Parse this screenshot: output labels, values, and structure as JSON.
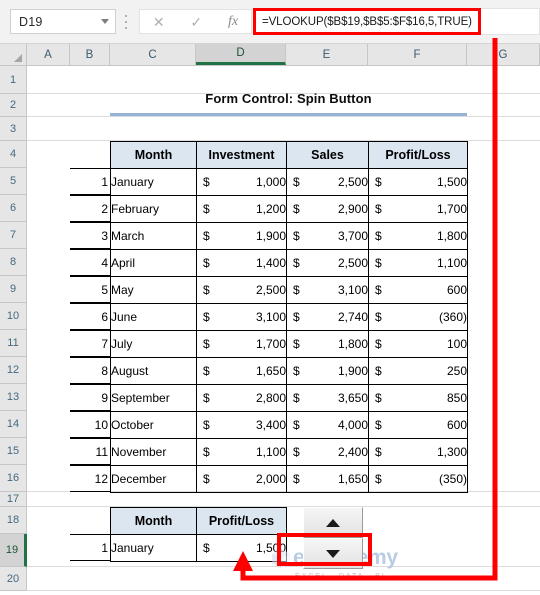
{
  "formula_bar": {
    "name_box_value": "D19",
    "formula": "=VLOOKUP($B$19,$B$5:$F$16,5,TRUE)",
    "cancel_icon": "cancel-x-icon",
    "enter_icon": "checkmark-icon",
    "fx_icon": "fx",
    "cancel_glyph": "✕",
    "enter_glyph": "✓"
  },
  "columns": [
    "A",
    "B",
    "C",
    "D",
    "E",
    "F",
    "G"
  ],
  "selected_column": "D",
  "rows": [
    "1",
    "2",
    "3",
    "4",
    "5",
    "6",
    "7",
    "8",
    "9",
    "10",
    "11",
    "12",
    "13",
    "14",
    "15",
    "16",
    "17",
    "18",
    "19",
    "20"
  ],
  "selected_row": "19",
  "sheet": {
    "title": "Form Control: Spin Button"
  },
  "main_table": {
    "headers": [
      "Month",
      "Investment",
      "Sales",
      "Profit/Loss"
    ],
    "rows": [
      {
        "index": "1",
        "month": "January",
        "investment": "1,000",
        "sales": "2,500",
        "profit_loss": "1,500"
      },
      {
        "index": "2",
        "month": "February",
        "investment": "1,200",
        "sales": "2,900",
        "profit_loss": "1,700"
      },
      {
        "index": "3",
        "month": "March",
        "investment": "1,900",
        "sales": "3,700",
        "profit_loss": "1,800"
      },
      {
        "index": "4",
        "month": "April",
        "investment": "1,400",
        "sales": "2,500",
        "profit_loss": "1,100"
      },
      {
        "index": "5",
        "month": "May",
        "investment": "2,500",
        "sales": "3,100",
        "profit_loss": "600"
      },
      {
        "index": "6",
        "month": "June",
        "investment": "3,100",
        "sales": "2,740",
        "profit_loss": "(360)"
      },
      {
        "index": "7",
        "month": "July",
        "investment": "1,700",
        "sales": "1,800",
        "profit_loss": "100"
      },
      {
        "index": "8",
        "month": "August",
        "investment": "1,650",
        "sales": "1,900",
        "profit_loss": "250"
      },
      {
        "index": "9",
        "month": "September",
        "investment": "2,800",
        "sales": "3,650",
        "profit_loss": "850"
      },
      {
        "index": "10",
        "month": "October",
        "investment": "3,400",
        "sales": "4,000",
        "profit_loss": "600"
      },
      {
        "index": "11",
        "month": "November",
        "investment": "1,100",
        "sales": "2,400",
        "profit_loss": "1,300"
      },
      {
        "index": "12",
        "month": "December",
        "investment": "2,000",
        "sales": "1,650",
        "profit_loss": "(350)"
      }
    ],
    "currency_symbol": "$"
  },
  "lookup_table": {
    "headers": [
      "Month",
      "Profit/Loss"
    ],
    "row": {
      "index": "1",
      "month": "January",
      "profit_loss": "1,500"
    },
    "currency_symbol": "$"
  },
  "spin_button": {
    "up_icon": "triangle-up-icon",
    "down_icon": "triangle-down-icon"
  },
  "annotation": {
    "highlight_color": "#ff0000"
  },
  "watermark": {
    "main": "exceldemy",
    "sub": "EXCEL - DATA - BI"
  }
}
